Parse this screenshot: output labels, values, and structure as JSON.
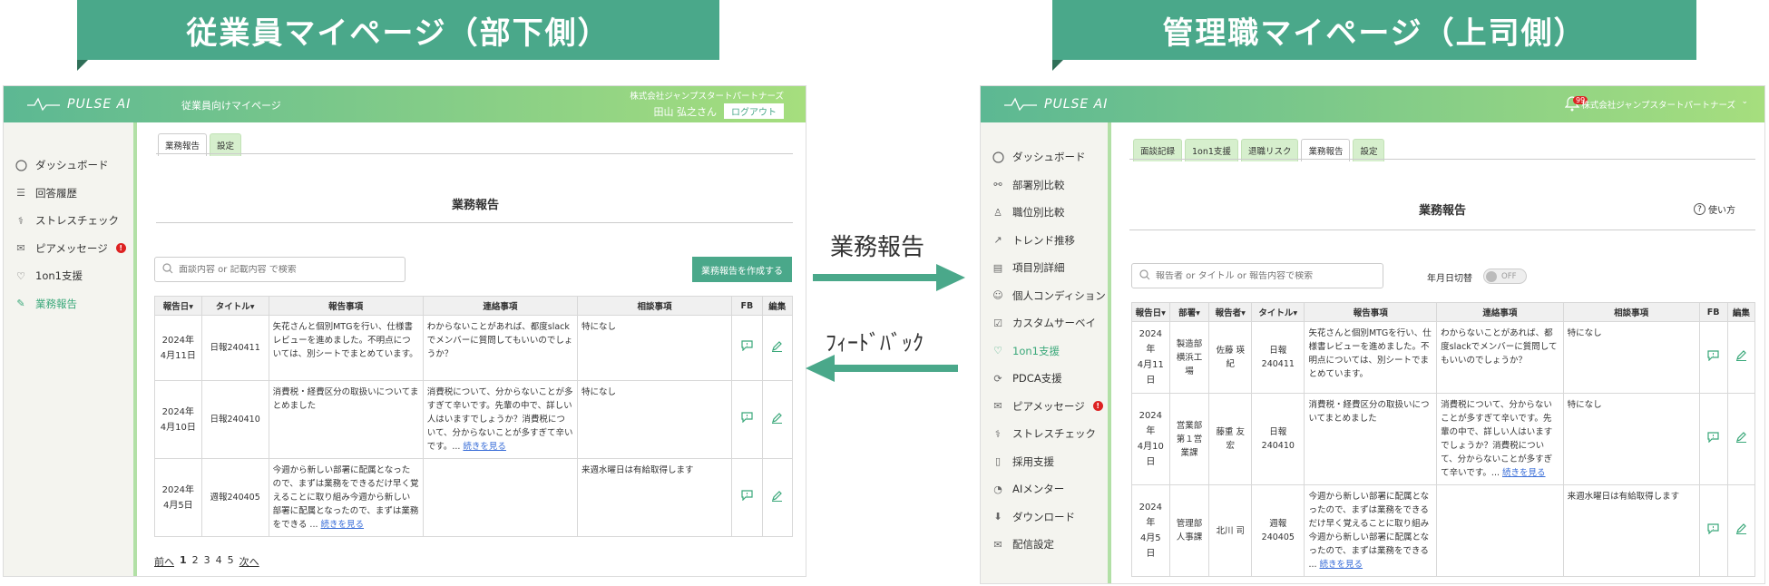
{
  "banners": {
    "left": "従業員マイページ（部下側）",
    "right": "管理職マイページ（上司側）"
  },
  "arrows": {
    "report": "業務報告",
    "feedback": "ﾌｨｰﾄﾞﾊﾞｯｸ"
  },
  "employee": {
    "logo": "PULSE AI",
    "subtitle": "従業員向けマイページ",
    "company": "株式会社ジャンプスタートパートナーズ",
    "user": "田山 弘之さん",
    "logout": "ログアウト",
    "nav": [
      {
        "label": "ダッシュボード",
        "icon": "dashboard-icon"
      },
      {
        "label": "回答履歴",
        "icon": "list-icon"
      },
      {
        "label": "ストレスチェック",
        "icon": "stress-icon"
      },
      {
        "label": "ピアメッセージ",
        "icon": "message-icon",
        "badge": "!"
      },
      {
        "label": "1on1支援",
        "icon": "heart-icon"
      },
      {
        "label": "業務報告",
        "icon": "report-icon",
        "active": true
      }
    ],
    "tabs": [
      "業務報告",
      "設定"
    ],
    "title": "業務報告",
    "search_placeholder": "面談内容 or 記載内容 で検索",
    "create_button": "業務報告を作成する",
    "columns": [
      "報告日▾",
      "タイトル▾",
      "報告事項",
      "連絡事項",
      "相談事項",
      "FB",
      "編集"
    ],
    "rows": [
      {
        "date1": "2024年",
        "date2": "4月11日",
        "title": "日報240411",
        "report": "矢花さんと個別MTGを行い、仕様書レビューを進めました。不明点については、別シートでまとめています。",
        "contact": "わからないことがあれば、都度slackでメンバーに質問してもいいのでしょうか？",
        "contact_more": "",
        "consult": "特になし"
      },
      {
        "date1": "2024年",
        "date2": "4月10日",
        "title": "日報240410",
        "report": "消費税・経費区分の取扱いについてまとめました",
        "contact": "消費税について、分からないことが多すぎて辛いです。先輩の中で、詳しい人はいますでしょうか？消費税について、分からないことが多すぎて辛いです。...",
        "contact_more": "続きを見る",
        "consult": "特になし"
      },
      {
        "date1": "2024年",
        "date2": "4月5日",
        "title": "週報240405",
        "report": "今週から新しい部署に配属となったので、まずは業務をできるだけ早く覚えることに取り組み今週から新しい部署に配属となったので、まずは業務をできる ...",
        "report_more": "続きを見る",
        "contact": "",
        "contact_more": "",
        "consult": "来週水曜日は有給取得します"
      }
    ],
    "pager": {
      "prev": "前へ",
      "pages": [
        "1",
        "2",
        "3",
        "4",
        "5"
      ],
      "next": "次へ"
    }
  },
  "manager": {
    "logo": "PULSE AI",
    "company": "株式会社ジャンプスタートパートナーズ",
    "notif_count": "99",
    "nav": [
      {
        "label": "ダッシュボード",
        "icon": "dashboard-icon"
      },
      {
        "label": "部署別比較",
        "icon": "org-icon"
      },
      {
        "label": "職位別比較",
        "icon": "person-icon"
      },
      {
        "label": "トレンド推移",
        "icon": "trend-icon"
      },
      {
        "label": "項目別詳細",
        "icon": "detail-icon"
      },
      {
        "label": "個人コンディション",
        "icon": "condition-icon"
      },
      {
        "label": "カスタムサーベイ",
        "icon": "survey-icon"
      },
      {
        "label": "1on1支援",
        "icon": "heart-icon",
        "active": true
      },
      {
        "label": "PDCA支援",
        "icon": "pdca-icon"
      },
      {
        "label": "ピアメッセージ",
        "icon": "message-icon",
        "badge": "!"
      },
      {
        "label": "ストレスチェック",
        "icon": "stress-icon"
      },
      {
        "label": "採用支援",
        "icon": "recruit-icon"
      },
      {
        "label": "AIメンター",
        "icon": "ai-icon"
      },
      {
        "label": "ダウンロード",
        "icon": "download-icon"
      },
      {
        "label": "配信設定",
        "icon": "mail-icon"
      }
    ],
    "tabs": [
      "面談記録",
      "1on1支援",
      "退職リスク",
      "業務報告",
      "設定"
    ],
    "selected_tab": "業務報告",
    "title": "業務報告",
    "help": "使い方",
    "search_placeholder": "報告者 or タイトル or 報告内容で検索",
    "toggle_label": "年月日切替",
    "toggle_state": "OFF",
    "columns": [
      "報告日▾",
      "部署▾",
      "報告者▾",
      "タイトル▾",
      "報告事項",
      "連絡事項",
      "相談事項",
      "FB",
      "編集"
    ],
    "rows": [
      {
        "date1": "2024年",
        "date2": "4月11",
        "date3": "日",
        "dept": "製造部 横浜工場",
        "reporter": "佐藤 瑛紀",
        "title": "日報 240411",
        "report": "矢花さんと個別MTGを行い、仕様書レビューを進めました。不明点については、別シートでまとめています。",
        "contact": "わからないことがあれば、都度slackでメンバーに質問してもいいのでしょうか？",
        "contact_more": "",
        "consult": "特になし"
      },
      {
        "date1": "2024年",
        "date2": "4月10",
        "date3": "日",
        "dept": "営業部 第１営業課",
        "reporter": "藤重 友宏",
        "title": "日報 240410",
        "report": "消費税・経費区分の取扱いについてまとめました",
        "contact": "消費税について、分からないことが多すぎて辛いです。先輩の中で、詳しい人はいますでしょうか？消費税について、分からないことが多すぎて辛いです。...",
        "contact_more": "続きを見る",
        "consult": "特になし"
      },
      {
        "date1": "2024年",
        "date2": "4月5日",
        "date3": "",
        "dept": "管理部 人事課",
        "reporter": "北川 司",
        "title": "週報 240405",
        "report": "今週から新しい部署に配属となったので、まずは業務をできるだけ早く覚えることに取り組み今週から新しい部署に配属となったので、まずは業務をできる ...",
        "report_more": "続きを見る",
        "contact": "",
        "contact_more": "",
        "consult": "来週水曜日は有給取得します"
      }
    ]
  },
  "colors": {
    "accent": "#4aa88a",
    "active": "#3aa87a",
    "badge": "#dd2222",
    "link": "#3a6ed8"
  }
}
